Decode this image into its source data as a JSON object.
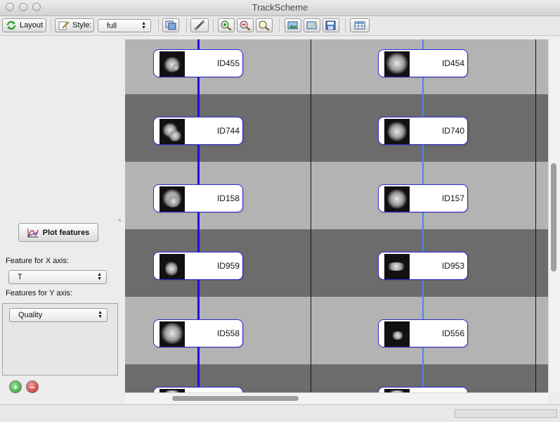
{
  "window": {
    "title": "TrackScheme"
  },
  "toolbar": {
    "layout_label": "Layout",
    "style_label": "Style:",
    "style_value": "full"
  },
  "side_panel": {
    "plot_button_label": "Plot features",
    "x_axis_label": "Feature for X axis:",
    "x_axis_value": "T",
    "y_axis_label": "Features for Y axis:",
    "y_axis_value": "Quality"
  },
  "tracks": {
    "left_line_color": "#2a00e6",
    "right_line_color": "#4a86f2",
    "rows": [
      {
        "left": "ID455",
        "right": "ID454"
      },
      {
        "left": "ID744",
        "right": "ID740"
      },
      {
        "left": "ID158",
        "right": "ID157"
      },
      {
        "left": "ID959",
        "right": "ID953"
      },
      {
        "left": "ID558",
        "right": "ID556"
      }
    ]
  },
  "colors": {
    "band_light": "#b3b3b3",
    "band_dark": "#6c6c6c",
    "node_border": "#2b2bd4"
  }
}
